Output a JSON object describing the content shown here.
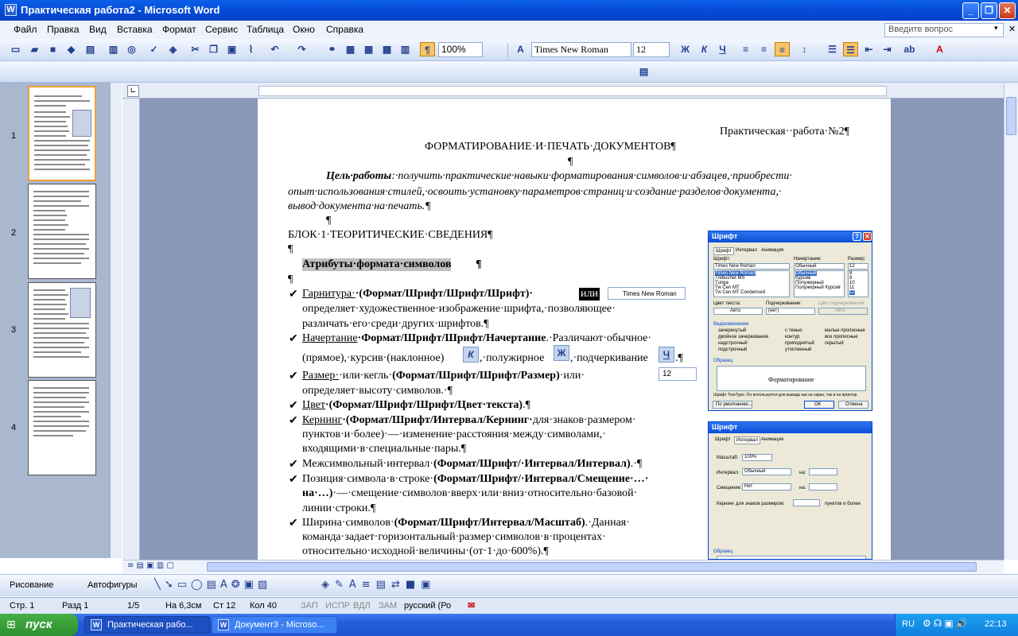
{
  "window": {
    "title": "Практическая  работа2 - Microsoft Word",
    "min": "_",
    "max": "❐",
    "close": "✕"
  },
  "menu": [
    "Файл",
    "Правка",
    "Вид",
    "Вставка",
    "Формат",
    "Сервис",
    "Таблица",
    "Окно",
    "Справка"
  ],
  "ask_placeholder": "Введите вопрос",
  "toolbar": {
    "zoom": "100%",
    "font": "Times New Roman",
    "size": "12",
    "bold": "Ж",
    "italic": "К",
    "underline": "Ч"
  },
  "thumbs": [
    "1",
    "2",
    "3",
    "4"
  ],
  "doc": {
    "header": "Практическая··работа·№2¶",
    "title": "ФОРМАТИРОВАНИЕ·И·ПЕЧАТЬ·ДОКУМЕНТОВ¶",
    "pilcrow": "¶",
    "goal_label": "Цель·работы",
    "goal_1": ":·получить·практические·навыки·форматирования·символов·и·абзацев,·приобрести·",
    "goal_2": "опыт·использования·стилей,·освоить·установку·параметров·страниц·и·создание·разделов·документа,·",
    "goal_3": "вывод·документа·на·печать.¶",
    "block1": "БЛОК·1·ТЕОРИТИЧЕСКИЕ·СВЕДЕНИЯ¶",
    "attrs": "Атрибуты·формата·символов",
    "l1a": "Гарнитура·",
    "l1b": "·(Формат/Шрифт/Шрифт/Шрифт)·",
    "l1c": "или",
    "l1d": "определяет·художественное·изображение·шрифта,·позволяющее·",
    "l1e": "различать·его·среди·других·шрифтов.¶",
    "l2a": "Начертание",
    "l2b": "·Формат/Шрифт/Шрифт/Начертание",
    "l2c": ".·Различают·обычное·",
    "l2d": "(прямое),·курсив·(наклонное)",
    "l2e": ",·полужирное",
    "l2f": ",·подчеркивание",
    "l2g": ".¶",
    "l3a": "Размер·",
    "l3b": "·или·кегль·",
    "l3c": "(Формат/Шрифт/Шрифт/Размер)",
    "l3d": "·или·",
    "l3e": "определяет·высоту·символов.·¶",
    "l4a": "Цвет",
    "l4b": "·(Формат/Шрифт/Шрифт/Цвет·текста)",
    "l4c": ".¶",
    "l5a": "Кернинг",
    "l5b": "·(Формат/Шрифт/Интервал/Кернинг·",
    "l5c": "для·знаков·размером·",
    "l5d": "пунктов·и·более)·—·изменение·расстояния·между·символами,·",
    "l5e": "входящими·в·специальные·пары.¶",
    "l6a": "Межсимвольный·интервал·",
    "l6b": "(Формат/Шрифт/·Интервал/Интервал)",
    "l6c": ".·¶",
    "l7a": "Позиция·символа·в·строке·",
    "l7b": "(Формат/Шрифт/·Интервал/Смещение·…·",
    "l7c": "на·…)",
    "l7d": "·—·смещение·символов·вверх·или·вниз·относительно·базовой·",
    "l7e": "линии·строки.¶",
    "l8a": "Ширина·символов·",
    "l8b": "(Формат/Шрифт/Интервал/Масштаб)",
    "l8c": ".·Данная·",
    "l8d": "команда·задает·горизонтальный·размер·символов·в·процентах·",
    "l8e": "относительно·исходной·величины·(от·1·до·600%).¶",
    "check": "✔",
    "inline_font": "Times New Roman",
    "inline_size": "12",
    "btn_k": "К",
    "btn_zh": "Ж",
    "btn_ch": "Ч"
  },
  "dialog1": {
    "title": "Шрифт",
    "tabs": [
      "Шрифт",
      "Интервал",
      "Анимация"
    ],
    "font_label": "Шрифт:",
    "style_label": "Начертание:",
    "size_label": "Размер:",
    "font_val": "Times New Roman",
    "style_val": "Обычный",
    "size_val": "12",
    "fonts": [
      "Times New Roman",
      "Trebuchet MS",
      "Tunga",
      "Tw Cen MT",
      "Tw Cen MT Condensed"
    ],
    "styles": [
      "Обычный",
      "Курсив",
      "Полужирный",
      "Полужирный Курсив"
    ],
    "sizes": [
      "8",
      "9",
      "10",
      "11",
      "12"
    ],
    "color_label": "Цвет текста:",
    "color_val": "Авто",
    "under_label": "Подчеркивание:",
    "under_val": "(нет)",
    "ucolor_label": "Цвет подчеркивания:",
    "ucolor_val": "Авто",
    "mods_label": "Видоизменение",
    "mods": [
      "зачеркнутый",
      "двойное зачеркивание",
      "надстрочный",
      "подстрочный",
      "с тенью",
      "контур",
      "приподнятый",
      "утопленный",
      "малые прописные",
      "все прописные",
      "скрытый"
    ],
    "sample_label": "Образец",
    "sample": "Форматирование",
    "note": "Шрифт TrueType. Он используется для вывода как на экран, так и на принтер.",
    "default_btn": "По умолчанию...",
    "ok": "ОК",
    "cancel": "Отмена"
  },
  "dialog2": {
    "title": "Шрифт",
    "tabs": [
      "Шрифт",
      "Интервал",
      "Анимация"
    ],
    "scale_label": "Масштаб:",
    "scale_val": "100%",
    "interval_label": "Интервал:",
    "interval_val": "Обычный",
    "on1": "на:",
    "shift_label": "Смещение:",
    "shift_val": "Нет",
    "on2": "на:",
    "kern_label": "Кернинг для знаков размером:",
    "kern_tail": "пунктов и более",
    "sample_label": "Образец"
  },
  "drawbar": {
    "draw": "Рисование",
    "autoshapes": "Автофигуры"
  },
  "status": {
    "page": "Стр.  1",
    "section": "Разд  1",
    "pages": "1/5",
    "at": "На 6,3см",
    "line": "Ст  12",
    "col": "Кол  40",
    "rec": "ЗАП",
    "trk": "ИСПР",
    "ext": "ВДЛ",
    "ovr": "ЗАМ",
    "lang": "русский (Ро"
  },
  "taskbar": {
    "start": "пуск",
    "task1": "Практическая  рабо...",
    "task2": "Документ3 - Microso...",
    "lang": "RU",
    "time": "22:13"
  }
}
